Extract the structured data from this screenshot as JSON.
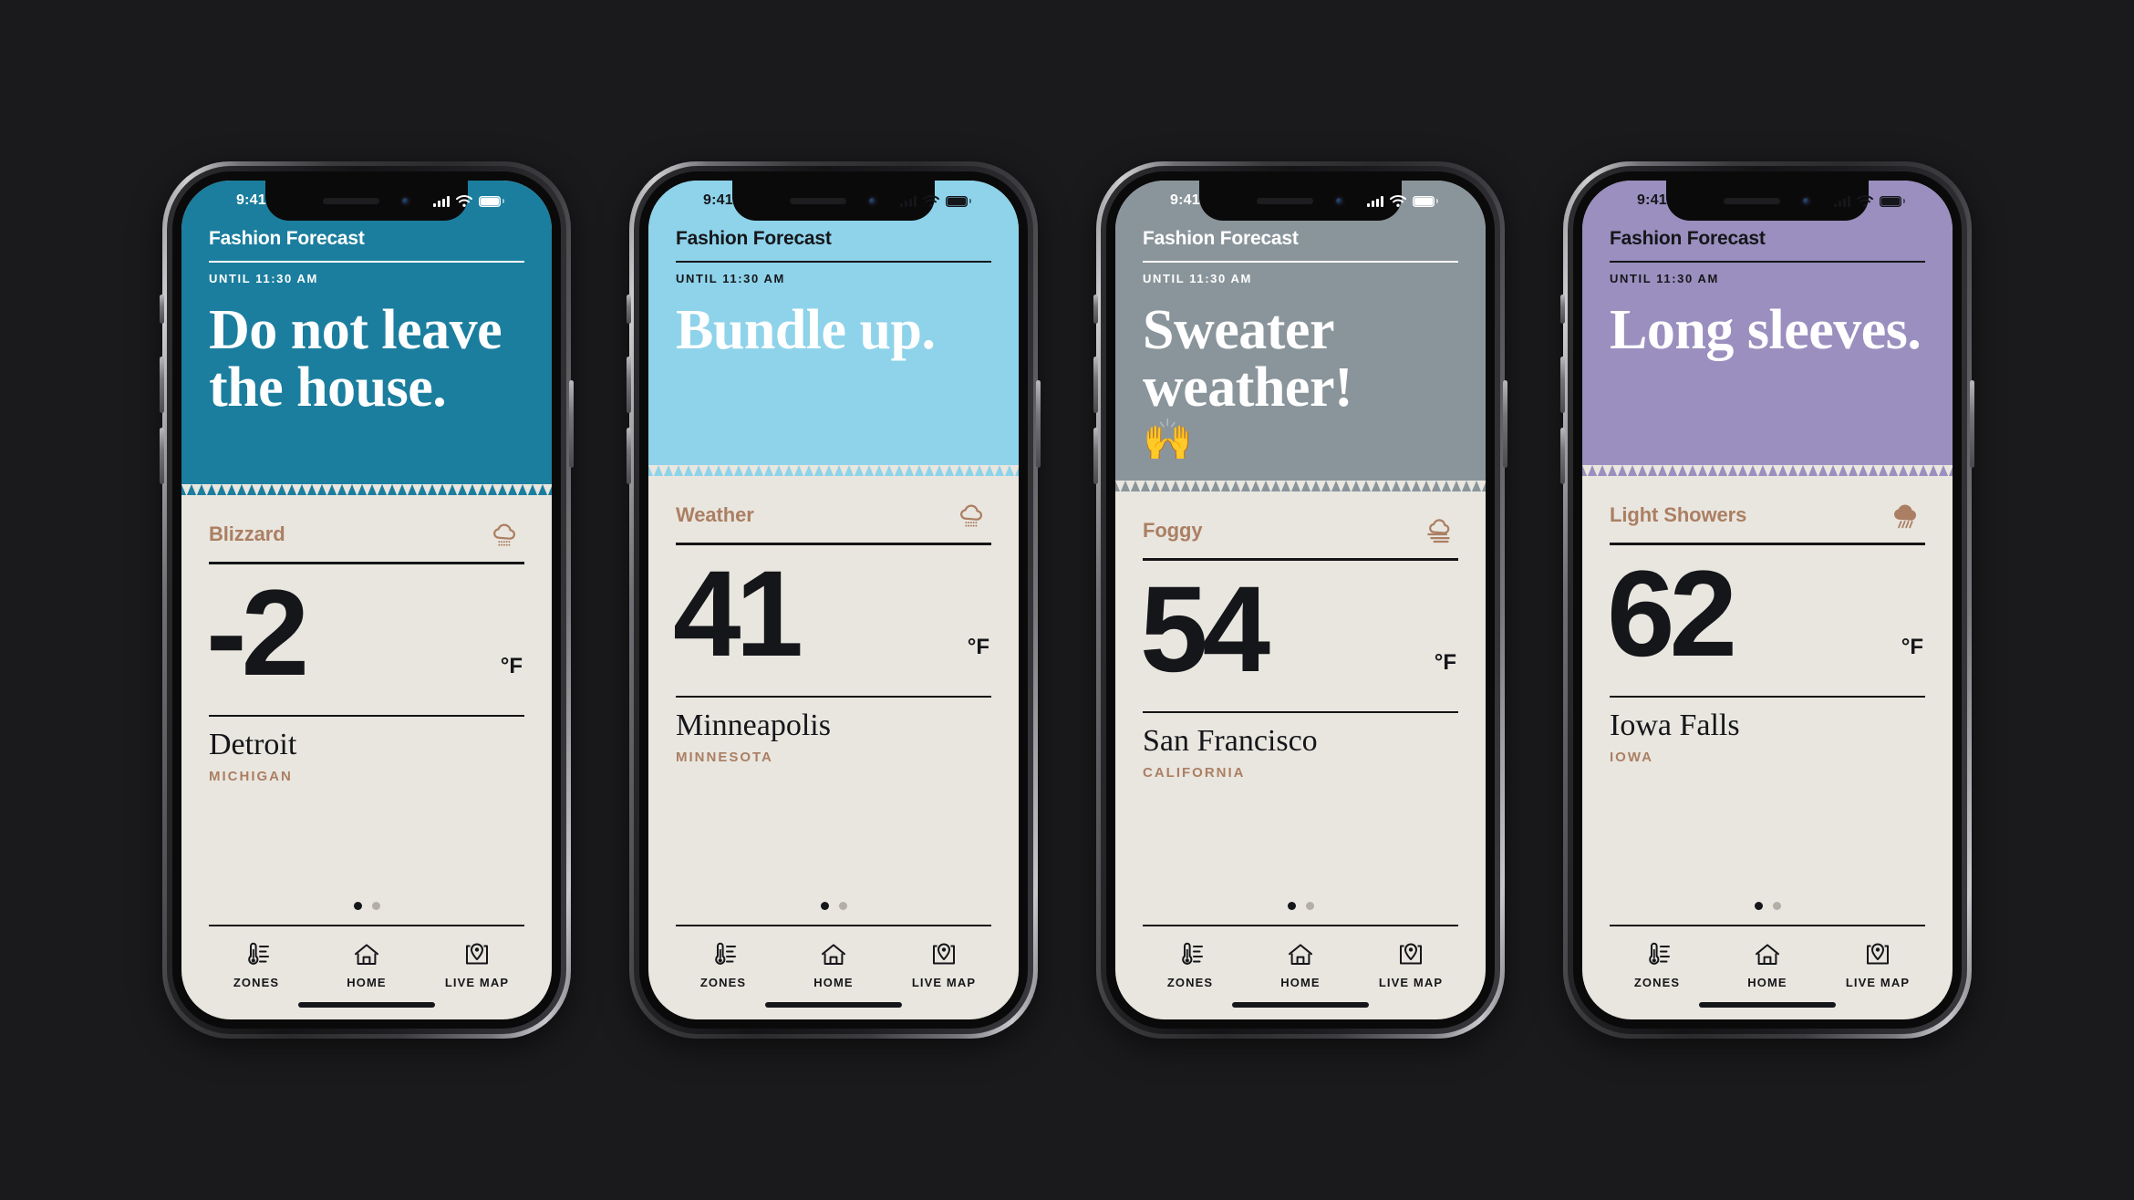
{
  "app": {
    "header_title": "Fashion Forecast",
    "until_label": "UNTIL 11:30 AM",
    "status_time": "9:41",
    "unit_symbol": "°F",
    "accent_color": "#ab7f63",
    "card_bg": "#e9e6df",
    "ink_color": "#15161a"
  },
  "tabs": [
    {
      "label": "ZONES",
      "icon": "thermometer-icon"
    },
    {
      "label": "HOME",
      "icon": "home-icon"
    },
    {
      "label": "LIVE MAP",
      "icon": "map-pin-icon"
    }
  ],
  "pagination": {
    "total": 2,
    "active": 0
  },
  "screens": [
    {
      "hero_bg": "#1b7e9e",
      "hero_text_color": "#ffffff",
      "header_color": "#ffffff",
      "message": "Do not leave the house.",
      "emoji": "",
      "condition": "Blizzard",
      "icon": "snow-cloud-icon",
      "temperature": "-2",
      "city": "Detroit",
      "state": "MICHIGAN"
    },
    {
      "hero_bg": "#8ed3ea",
      "hero_text_color": "#ffffff",
      "header_color": "#15161a",
      "message": "Bundle up.",
      "emoji": "",
      "condition": "Weather",
      "icon": "snow-cloud-icon",
      "temperature": "41",
      "city": "Minneapolis",
      "state": "MINNESOTA"
    },
    {
      "hero_bg": "#8a959b",
      "hero_text_color": "#ffffff",
      "header_color": "#ffffff",
      "message": "Sweater weather!",
      "emoji": "🙌",
      "condition": "Foggy",
      "icon": "fog-cloud-icon",
      "temperature": "54",
      "city": "San Francisco",
      "state": "CALIFORNIA"
    },
    {
      "hero_bg": "#9a8fbe",
      "hero_text_color": "#ffffff",
      "header_color": "#15161a",
      "message": "Long sleeves.",
      "emoji": "",
      "condition": "Light Showers",
      "icon": "rain-cloud-icon",
      "temperature": "62",
      "city": "Iowa Falls",
      "state": "IOWA"
    }
  ]
}
